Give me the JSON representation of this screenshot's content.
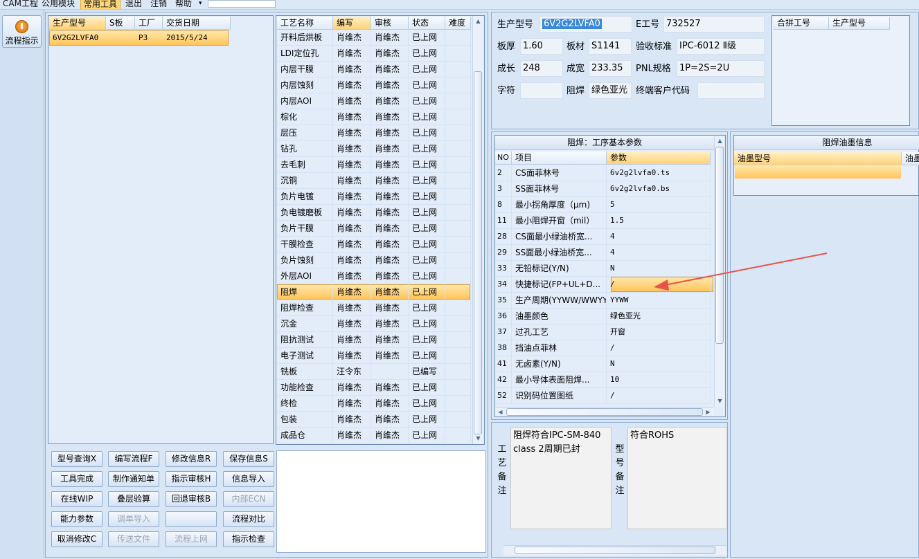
{
  "menubar": {
    "items": [
      "CAM工程",
      "公用模块",
      "常用工具",
      "退出",
      "注销",
      "帮助"
    ],
    "active": "常用工具",
    "dropdown_arrow": "▾"
  },
  "leftbar": {
    "flow_button": "流程指示",
    "flow_icon": "power-icon"
  },
  "model_grid": {
    "headers": [
      "生产型号",
      "S板",
      "工厂",
      "交货日期"
    ],
    "rows": [
      [
        "6V2G2LVFA0",
        "",
        "P3",
        "2015/5/24"
      ]
    ]
  },
  "process_grid": {
    "headers": [
      "工艺名称",
      "编写",
      "审核",
      "状态",
      "难度"
    ],
    "rows": [
      [
        "开料后烘板",
        "肖维杰",
        "肖维杰",
        "已上网",
        ""
      ],
      [
        "LDI定位孔",
        "肖维杰",
        "肖维杰",
        "已上网",
        ""
      ],
      [
        "内层干膜",
        "肖维杰",
        "肖维杰",
        "已上网",
        ""
      ],
      [
        "内层蚀刻",
        "肖维杰",
        "肖维杰",
        "已上网",
        ""
      ],
      [
        "内层AOI",
        "肖维杰",
        "肖维杰",
        "已上网",
        ""
      ],
      [
        "棕化",
        "肖维杰",
        "肖维杰",
        "已上网",
        ""
      ],
      [
        "层压",
        "肖维杰",
        "肖维杰",
        "已上网",
        ""
      ],
      [
        "钻孔",
        "肖维杰",
        "肖维杰",
        "已上网",
        ""
      ],
      [
        "去毛刺",
        "肖维杰",
        "肖维杰",
        "已上网",
        ""
      ],
      [
        "沉铜",
        "肖维杰",
        "肖维杰",
        "已上网",
        ""
      ],
      [
        "负片电镀",
        "肖维杰",
        "肖维杰",
        "已上网",
        ""
      ],
      [
        "负电镀磨板",
        "肖维杰",
        "肖维杰",
        "已上网",
        ""
      ],
      [
        "负片干膜",
        "肖维杰",
        "肖维杰",
        "已上网",
        ""
      ],
      [
        "干膜检查",
        "肖维杰",
        "肖维杰",
        "已上网",
        ""
      ],
      [
        "负片蚀刻",
        "肖维杰",
        "肖维杰",
        "已上网",
        ""
      ],
      [
        "外层AOI",
        "肖维杰",
        "肖维杰",
        "已上网",
        ""
      ],
      [
        "阻焊",
        "肖维杰",
        "肖维杰",
        "已上网",
        ""
      ],
      [
        "阻焊检查",
        "肖维杰",
        "肖维杰",
        "已上网",
        ""
      ],
      [
        "沉金",
        "肖维杰",
        "肖维杰",
        "已上网",
        ""
      ],
      [
        "阻抗测试",
        "肖维杰",
        "肖维杰",
        "已上网",
        ""
      ],
      [
        "电子测试",
        "肖维杰",
        "肖维杰",
        "已上网",
        ""
      ],
      [
        "铣板",
        "汪令东",
        "",
        "已编写",
        ""
      ],
      [
        "功能检查",
        "肖维杰",
        "肖维杰",
        "已上网",
        ""
      ],
      [
        "终检",
        "肖维杰",
        "肖维杰",
        "已上网",
        ""
      ],
      [
        "包装",
        "肖维杰",
        "肖维杰",
        "已上网",
        ""
      ],
      [
        "成品仓",
        "肖维杰",
        "肖维杰",
        "已上网",
        ""
      ]
    ],
    "selected_index": 16
  },
  "buttons": [
    [
      "型号查询X",
      "编写流程F",
      "修改信息R",
      "保存信息S"
    ],
    [
      "工具完成",
      "制作通知单",
      "指示审核H",
      "信息导入"
    ],
    [
      "在线WIP",
      "叠层验算",
      "回退审核B",
      "内部ECN"
    ],
    [
      "能力参数",
      "调单导入",
      "",
      "流程对比"
    ],
    [
      "取消修改C",
      "传送文件",
      "流程上网",
      "指示检查"
    ]
  ],
  "disabled_buttons": [
    "内部ECN",
    "调单导入",
    "传送文件",
    "流程上网",
    ""
  ],
  "info": {
    "model_label": "生产型号",
    "model_value": "6V2G2LVFA0",
    "e_label": "E工号",
    "e_value": "732527",
    "thick_label": "板厚",
    "thick_value": "1.60",
    "material_label": "板材",
    "material_value": "S1141",
    "accept_label": "验收标准",
    "accept_value": "IPC-6012 Ⅱ级",
    "len_label": "成长",
    "len_value": "248",
    "width_label": "成宽",
    "width_value": "233.35",
    "pnl_label": "PNL规格",
    "pnl_value": "1P=2S=2U",
    "char_label": "字符",
    "char_value": "",
    "mask_label": "阻焊",
    "mask_value": "绿色亚光",
    "cust_label": "终端客户代码",
    "cust_value": ""
  },
  "merge_grid": {
    "headers": [
      "合拼工号",
      "生产型号"
    ]
  },
  "params": {
    "title": "阻焊：工序基本参数",
    "headers": [
      "NO",
      "项目",
      "参数"
    ],
    "rows": [
      [
        "2",
        "CS面菲林号",
        "6v2g2lvfa0.ts"
      ],
      [
        "3",
        "SS面菲林号",
        "6v2g2lvfa0.bs"
      ],
      [
        "8",
        "最小拐角厚度（μm)",
        "5"
      ],
      [
        "11",
        "最小阻焊开窗（mil）",
        "1.5"
      ],
      [
        "28",
        "CS面最小绿油桥宽...",
        "4"
      ],
      [
        "29",
        "SS面最小绿油桥宽...",
        "4"
      ],
      [
        "33",
        "无铅标记(Y/N)",
        "N"
      ],
      [
        "34",
        "快捷标记(FP+UL+D...",
        "/"
      ],
      [
        "35",
        "生产周期(YYWW/WWYY)",
        "YYWW"
      ],
      [
        "36",
        "油墨颜色",
        "绿色亚光"
      ],
      [
        "37",
        "过孔工艺",
        "开窗"
      ],
      [
        "38",
        "挡油点菲林",
        "/"
      ],
      [
        "41",
        "无卤素(Y/N)",
        "N"
      ],
      [
        "42",
        "最小导体表面阻焊...",
        "10"
      ],
      [
        "52",
        "识别码位置图纸",
        "/"
      ]
    ],
    "selected_index": 7
  },
  "ink": {
    "title": "阻焊油墨信息",
    "headers": [
      "油墨型号",
      "油墨"
    ]
  },
  "notes": {
    "process_label": "工艺备注",
    "process_text": "阻焊符合IPC-SM-840 class 2周期已封",
    "model_label": "型号备注",
    "model_text": "符合ROHS"
  },
  "colors": {
    "selection": "#ffc55a",
    "arrow": "#e8534a",
    "panel": "#d8e6f6"
  }
}
